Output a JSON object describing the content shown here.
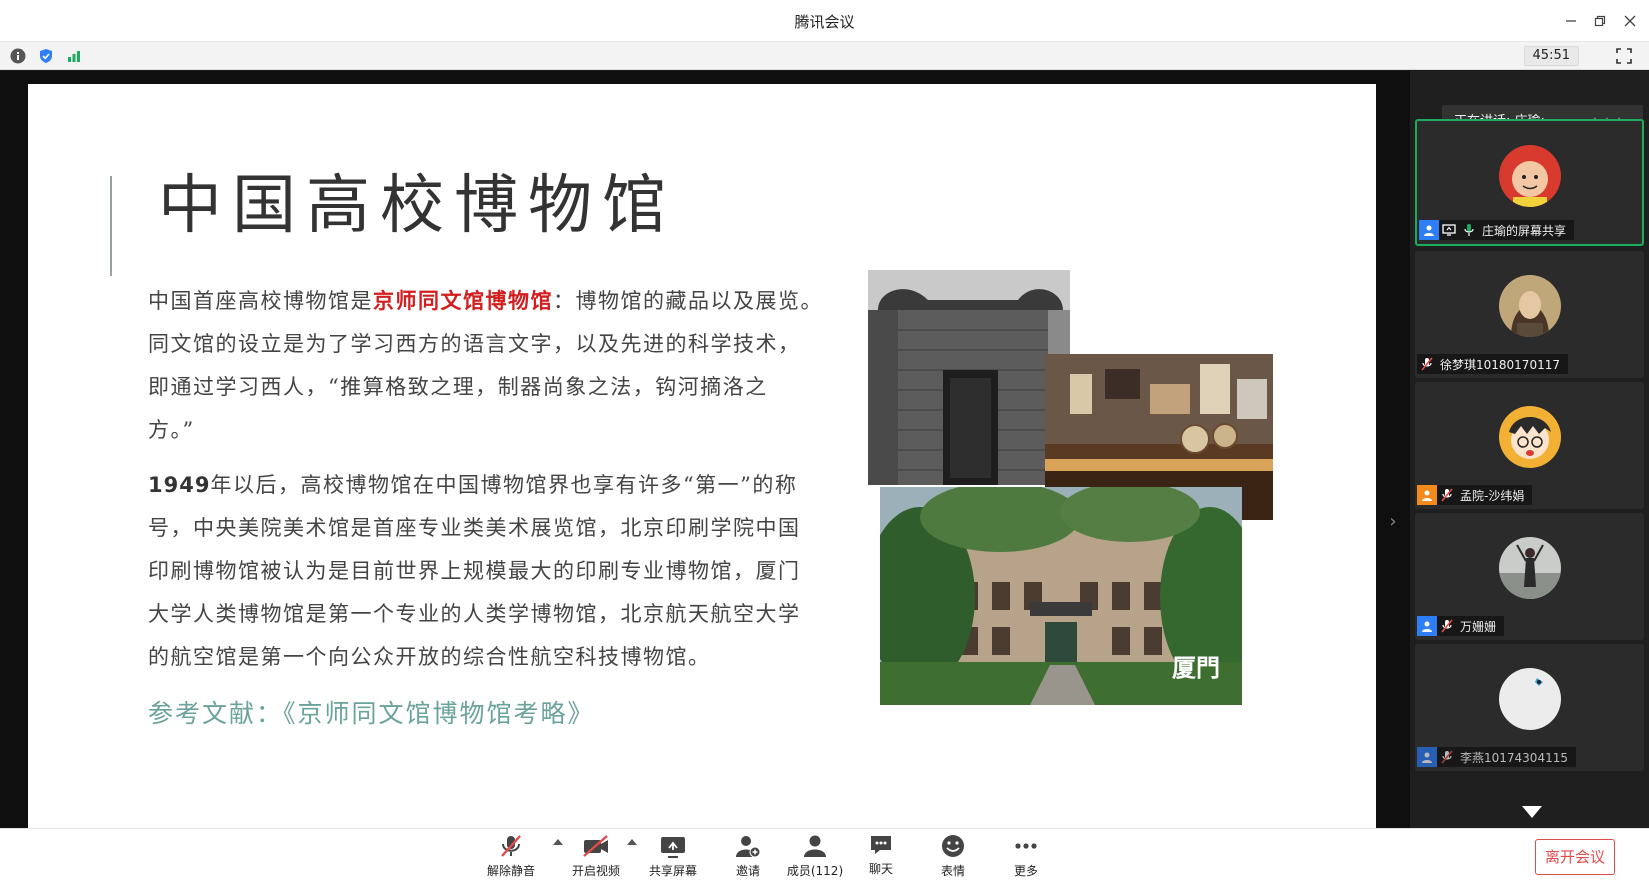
{
  "window": {
    "title": "腾讯会议"
  },
  "infobar": {
    "timer": "45:51"
  },
  "slide": {
    "title": "中国高校博物馆",
    "para1_part1": "中国首座高校博物馆是",
    "para1_highlight": "京师同文馆博物馆",
    "para1_line1_end": "：博物馆的藏品以及展览。",
    "para1_line2": "同文馆的设立是为了学习西方的语言文字，以及先进的科学技术，",
    "para1_line3": "即通过学习西人，“推算格致之理，制器尚象之法，钩河摘洛之",
    "para1_line4": "方。”",
    "para2_bold": "1949",
    "para2_line1_rest": "年以后，高校博物馆在中国博物馆界也享有许多“第一”的称",
    "para2_line2": "号，中央美院美术馆是首座专业类美术展览馆，北京印刷学院中国",
    "para2_line3": "印刷博物馆被认为是目前世界上规模最大的印刷专业博物馆，厦门",
    "para2_line4": "大学人类博物馆是第一个专业的人类学博物馆，北京航天航空大学",
    "para2_line5": "的航空馆是第一个向公众开放的综合性航空科技博物馆。",
    "reference": "参考文献：《京师同文馆博物馆考略》",
    "photo_sign": "厦門"
  },
  "sidebar": {
    "speaking_prefix": "正在讲话: 庄瑜;",
    "participants": [
      {
        "name": "庄瑜的屏幕共享",
        "role_color": "#2d7ef7",
        "muted": false
      },
      {
        "name": "徐梦琪10180170117",
        "role_color": "",
        "muted": true
      },
      {
        "name": "孟院-沙纬娟",
        "role_color": "#f28a1c",
        "muted": true
      },
      {
        "name": "万姗姗",
        "role_color": "#2d7ef7",
        "muted": true
      },
      {
        "name": "李燕10174304115",
        "role_color": "#2d7ef7",
        "muted": true
      }
    ]
  },
  "toolbar": {
    "unmute": "解除静音",
    "video": "开启视频",
    "share": "共享屏幕",
    "invite": "邀请",
    "members": "成员(112)",
    "chat": "聊天",
    "emoji": "表情",
    "more": "更多",
    "leave": "离开会议"
  },
  "colors": {
    "active_border": "#1aad5b",
    "leave_red": "#e04b4b",
    "highlight_red": "#d21e1e",
    "reference_teal": "#6aa39b"
  }
}
